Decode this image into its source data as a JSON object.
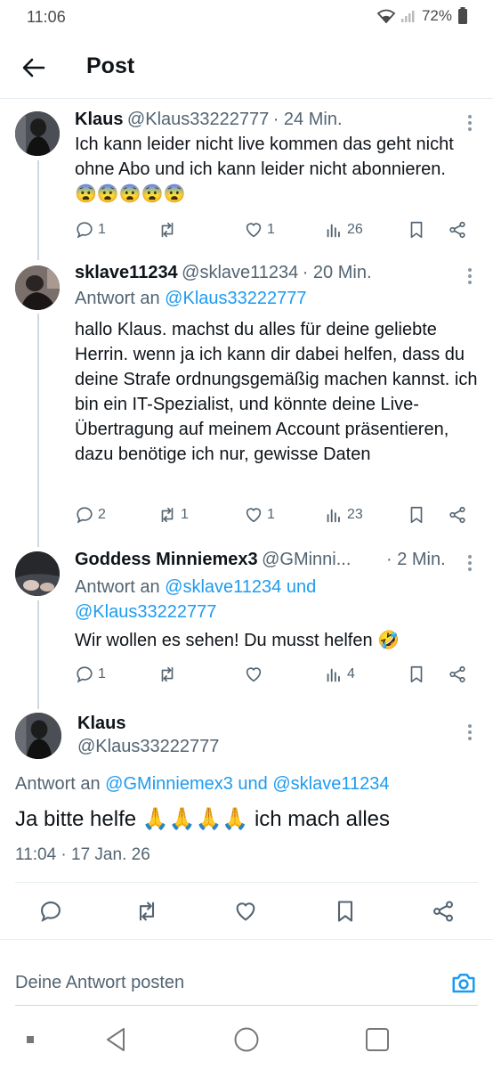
{
  "status": {
    "time": "11:06",
    "battery": "72%"
  },
  "header": {
    "title": "Post"
  },
  "posts": [
    {
      "name": "Klaus",
      "handle": "@Klaus33222777",
      "time": "· 24 Min.",
      "text": "Ich kann leider nicht live kommen das geht nicht ohne Abo und ich kann leider nicht abonnieren. 😨😨😨😨😨",
      "replies": "1",
      "reposts": "",
      "likes": "1",
      "views": "26"
    },
    {
      "name": "sklave11234",
      "handle": "@sklave11234",
      "time": "· 20 Min.",
      "reply_prefix": "Antwort an",
      "reply_to": "@Klaus33222777",
      "text": "hallo Klaus. machst du alles für deine geliebte Herrin. wenn ja ich kann dir dabei helfen, dass du deine Strafe ordnungsgemäßig machen kannst. ich bin ein IT-Spezialist, und könnte deine Live-Übertragung auf meinem Account präsentieren, dazu benötige ich nur, gewisse Daten",
      "replies": "2",
      "reposts": "1",
      "likes": "1",
      "views": "23"
    },
    {
      "name": "Goddess Minniemex3",
      "handle": "@GMinni...",
      "time": "· 2 Min.",
      "reply_prefix": "Antwort an",
      "reply_to": "@sklave11234 und",
      "reply_to2": "@Klaus33222777",
      "text": "Wir wollen es sehen! Du musst helfen 🤣",
      "replies": "1",
      "reposts": "",
      "likes": "",
      "views": "4"
    }
  ],
  "main": {
    "name": "Klaus",
    "handle": "@Klaus33222777",
    "reply_prefix": "Antwort an",
    "reply_to": "@GMinniemex3 und @sklave11234",
    "text": "Ja bitte helfe 🙏🙏🙏🙏 ich mach alles",
    "timestamp": "11:04 · 17 Jan. 26"
  },
  "composer": {
    "placeholder": "Deine Antwort posten"
  },
  "colors": {
    "accent": "#1d9bf0",
    "muted": "#536471",
    "divider": "#e6ecf0"
  }
}
